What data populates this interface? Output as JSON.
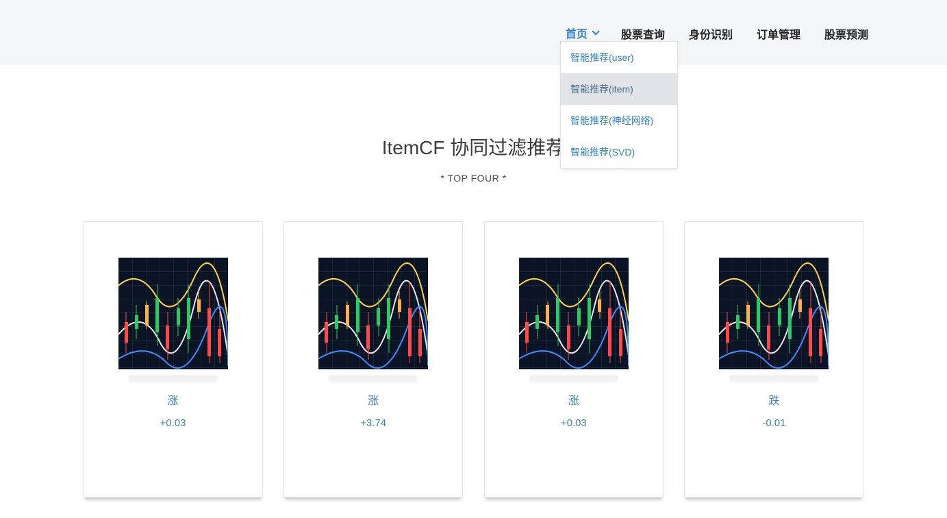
{
  "nav": {
    "items": [
      {
        "label": "首页",
        "active": true,
        "hasChevron": true
      },
      {
        "label": "股票查询",
        "active": false,
        "hasChevron": false
      },
      {
        "label": "身份识别",
        "active": false,
        "hasChevron": false
      },
      {
        "label": "订单管理",
        "active": false,
        "hasChevron": false
      },
      {
        "label": "股票预测",
        "active": false,
        "hasChevron": false
      }
    ],
    "dropdown": {
      "items": [
        {
          "label": "智能推荐(user)",
          "hovered": false
        },
        {
          "label": "智能推荐(item)",
          "hovered": true
        },
        {
          "label": "智能推荐(神经网络)",
          "hovered": false
        },
        {
          "label": "智能推荐(SVD)",
          "hovered": false
        }
      ]
    }
  },
  "main": {
    "title": "ItemCF 协同过滤推荐",
    "subtitle": "* TOP FOUR *"
  },
  "cards": [
    {
      "direction": "涨",
      "value": "+0.03"
    },
    {
      "direction": "涨",
      "value": "+3.74"
    },
    {
      "direction": "涨",
      "value": "+0.03"
    },
    {
      "direction": "跌",
      "value": "-0.01"
    }
  ]
}
